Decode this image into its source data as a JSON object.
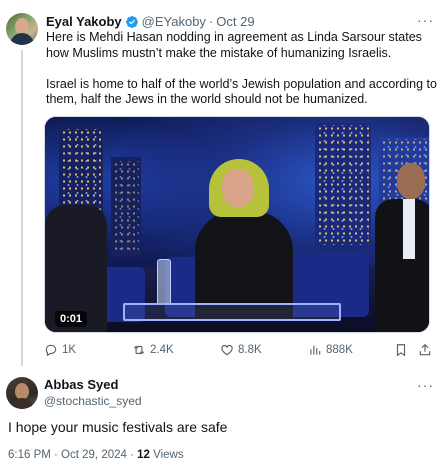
{
  "main_tweet": {
    "author_name": "Eyal Yakoby",
    "handle": "@EYakoby",
    "separator": "·",
    "date": "Oct 29",
    "more_label": "···",
    "paragraphs": [
      "Here is Mehdi Hasan nodding in agreement as Linda Sarsour states how Muslims mustn’t make the mistake of humanizing Israelis.",
      "Israel is home to half of the world’s Jewish population and according to them, half the Jews in the world should not be humanized."
    ],
    "video": {
      "duration": "0:01"
    },
    "actions": {
      "replies": "1K",
      "reposts": "2.4K",
      "likes": "8.8K",
      "views": "888K"
    }
  },
  "reply_tweet": {
    "author_name": "Abbas Syed",
    "handle": "@stochastic_syed",
    "more_label": "···",
    "text": "I hope your music festivals are safe",
    "timestamp": "6:16 PM · Oct 29, 2024 · ",
    "views_count": "12",
    "views_label": " Views"
  },
  "colors": {
    "verified_blue": "#1d9bf0",
    "secondary_text": "#536471",
    "primary_text": "#0f1419"
  }
}
